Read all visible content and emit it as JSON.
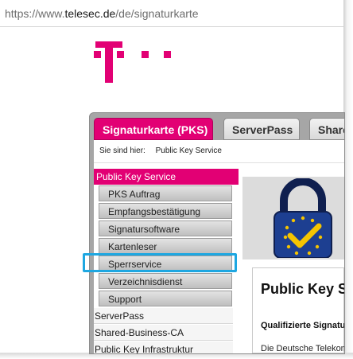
{
  "browser": {
    "url_prefix": "https://www.",
    "url_domain": "telesec.de",
    "url_path": "/de/signaturkarte"
  },
  "brand": {
    "color": "#e20074"
  },
  "tabs": [
    {
      "label": "Signaturkarte (PKS)",
      "active": true
    },
    {
      "label": "ServerPass",
      "active": false
    },
    {
      "label": "Shared",
      "active": false
    }
  ],
  "breadcrumb": {
    "label": "Sie sind hier:",
    "current": "Public Key Service"
  },
  "nav": {
    "section_active": "Public Key Service",
    "sub_items": [
      {
        "label": "PKS Auftrag"
      },
      {
        "label": "Empfangsbestätigung"
      },
      {
        "label": "Signatursoftware"
      },
      {
        "label": "Kartenleser"
      },
      {
        "label": "Sperrservice",
        "highlighted": true
      },
      {
        "label": "Verzeichnisdienst"
      },
      {
        "label": "Support"
      }
    ],
    "top_items": [
      {
        "label": "ServerPass"
      },
      {
        "label": "Shared-Business-CA"
      },
      {
        "label": "Public Key Infrastruktur"
      }
    ]
  },
  "content": {
    "heading": "Public Key Se",
    "subheading": "Qualifizierte Signatur",
    "paragraph": "Die Deutsche Telekom"
  }
}
